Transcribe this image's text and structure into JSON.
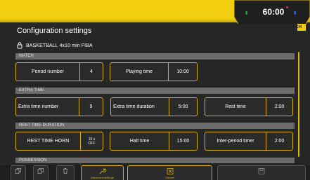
{
  "clock": {
    "time": "60:00",
    "back_label": "BACK TO MATCH"
  },
  "header": {
    "title": "Configuration settings",
    "subtitle": "BASKETBALL 4x10 min FIBA"
  },
  "sections": {
    "match": "MATCH",
    "extra_time": "EXTRA TIME",
    "rest_time_duration": "REST TIME DURATION",
    "possession": "POSSESSION"
  },
  "match": {
    "period_number": {
      "label": "Period number",
      "value": "4"
    },
    "playing_time": {
      "label": "Playing time",
      "value": "10:00"
    }
  },
  "extra_time": {
    "extra_time_number": {
      "label": "Extra time number",
      "value": "9"
    },
    "extra_time_duration": {
      "label": "Extra time duration",
      "value": "5:00"
    },
    "rest_time": {
      "label": "Rest time",
      "value": "2:00"
    }
  },
  "rest_time_duration": {
    "rest_time_horn": {
      "label": "REST TIME HORN",
      "value_line1": "10 s",
      "value_line2": "OFF"
    },
    "half_time": {
      "label": "Half time",
      "value": "15:00"
    },
    "inter_period_timer": {
      "label": "Inter-period timer",
      "value": "2:00"
    }
  },
  "bottom": {
    "btn1": "",
    "btn2": "",
    "btn3": "",
    "advanced": "Advanced settings",
    "cancel": "Cancel",
    "save": ""
  },
  "colors": {
    "accent": "#f2cf0f",
    "border": "#d9b414",
    "section_bg": "#6b6b6b",
    "bg": "#262626"
  },
  "icons": [
    "lock-icon",
    "copy-icon",
    "trash-icon",
    "wrench-icon",
    "close-icon",
    "save-icon"
  ]
}
